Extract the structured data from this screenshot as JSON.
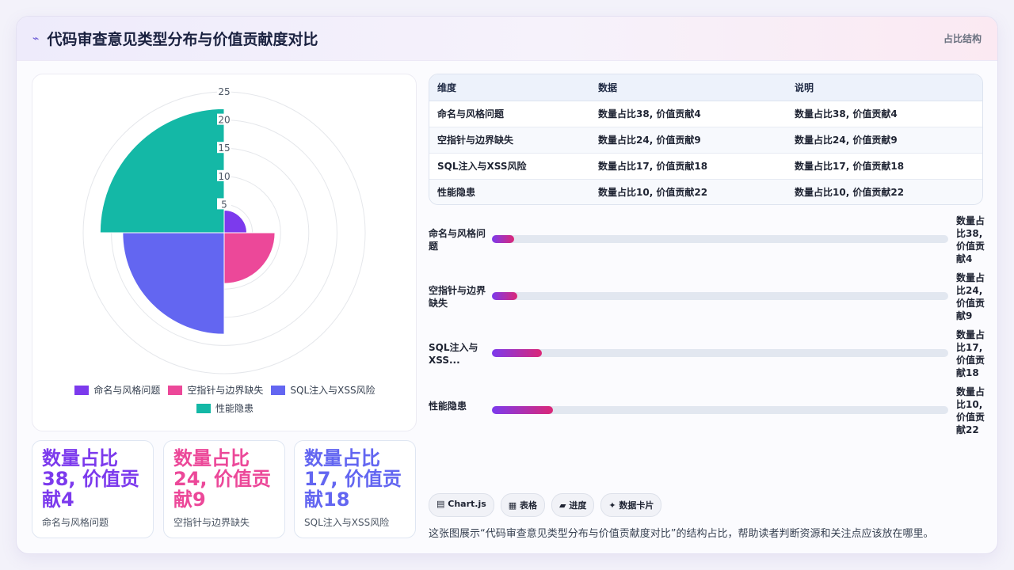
{
  "header": {
    "title": "代码审查意见类型分布与价值贡献度对比",
    "right_label": "占比结构"
  },
  "colors": {
    "naming": "#7c3aed",
    "nullptr": "#ec4899",
    "sql": "#6366f1",
    "perf": "#14b8a6",
    "grid": "#e5e7eb"
  },
  "chart_data": {
    "type": "polarArea",
    "categories": [
      "命名与风格问题",
      "空指针与边界缺失",
      "SQL注入与XSS风险",
      "性能隐患"
    ],
    "values": [
      4,
      9,
      18,
      22
    ],
    "colors": [
      "#7c3aed",
      "#ec4899",
      "#6366f1",
      "#14b8a6"
    ],
    "r_ticks": [
      "5",
      "10",
      "15",
      "20",
      "25"
    ],
    "r_max": 25,
    "legend_position": "bottom"
  },
  "legend": {
    "items": [
      {
        "label": "命名与风格问题",
        "color": "#7c3aed"
      },
      {
        "label": "空指针与边界缺失",
        "color": "#ec4899"
      },
      {
        "label": "SQL注入与XSS风险",
        "color": "#6366f1"
      },
      {
        "label": "性能隐患",
        "color": "#14b8a6"
      }
    ]
  },
  "stat_cards": [
    {
      "value": "数量占比38, 价值贡献4",
      "label": "命名与风格问题",
      "color": "#7c3aed"
    },
    {
      "value": "数量占比24, 价值贡献9",
      "label": "空指针与边界缺失",
      "color": "#ec4899"
    },
    {
      "value": "数量占比17, 价值贡献18",
      "label": "SQL注入与XSS风险",
      "color": "#6366f1"
    }
  ],
  "table": {
    "headers": [
      "维度",
      "数据",
      "说明"
    ],
    "rows": [
      [
        "命名与风格问题",
        "数量占比38, 价值贡献4",
        "数量占比38, 价值贡献4"
      ],
      [
        "空指针与边界缺失",
        "数量占比24, 价值贡献9",
        "数量占比24, 价值贡献9"
      ],
      [
        "SQL注入与XSS风险",
        "数量占比17, 价值贡献18",
        "数量占比17, 价值贡献18"
      ],
      [
        "性能隐患",
        "数量占比10, 价值贡献22",
        "数量占比10, 价值贡献22"
      ]
    ]
  },
  "progress": [
    {
      "label": "命名与风格问题",
      "value_text": "数量占比38, 价值贡献4",
      "fraction": 0.048
    },
    {
      "label": "空指针与边界缺失",
      "value_text": "数量占比24, 价值贡献9",
      "fraction": 0.055
    },
    {
      "label": "SQL注入与XSS...",
      "value_text": "数量占比17, 价值贡献18",
      "fraction": 0.11
    },
    {
      "label": "性能隐患",
      "value_text": "数量占比10, 价值贡献22",
      "fraction": 0.134
    }
  ],
  "tags": [
    {
      "icon": "▤",
      "label": "Chart.js"
    },
    {
      "icon": "▦",
      "label": "表格"
    },
    {
      "icon": "▰",
      "label": "进度"
    },
    {
      "icon": "✦",
      "label": "数据卡片"
    }
  ],
  "description": "这张图展示“代码审查意见类型分布与价值贡献度对比”的结构占比，帮助读者判断资源和关注点应该放在哪里。"
}
